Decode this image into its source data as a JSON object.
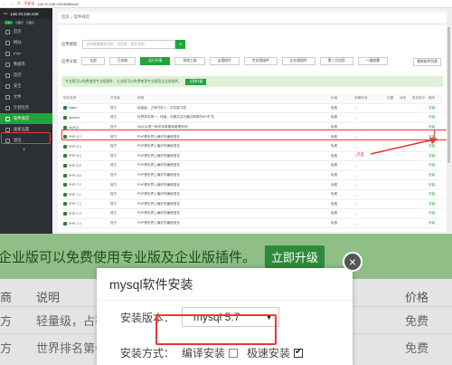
{
  "browser": {
    "warning": "不安全",
    "url": "148.70.236.239:8888/soft"
  },
  "sidebar": {
    "server": "148.70.236.239",
    "counts": [
      "0",
      "0",
      "0"
    ],
    "items": [
      {
        "label": "首页",
        "icon": "home-icon"
      },
      {
        "label": "网站",
        "icon": "globe-icon"
      },
      {
        "label": "FTP",
        "icon": "ftp-icon"
      },
      {
        "label": "数据库",
        "icon": "database-icon"
      },
      {
        "label": "监控",
        "icon": "monitor-icon"
      },
      {
        "label": "安全",
        "icon": "shield-icon"
      },
      {
        "label": "文件",
        "icon": "folder-icon"
      },
      {
        "label": "计划任务",
        "icon": "clock-icon"
      },
      {
        "label": "软件商店",
        "icon": "grid-icon"
      },
      {
        "label": "面板设置",
        "icon": "gear-icon"
      },
      {
        "label": "退出",
        "icon": "logout-icon"
      }
    ],
    "add": "+"
  },
  "breadcrumb": {
    "home": "首页",
    "sep": "/",
    "current": "软件商店"
  },
  "search": {
    "label": "应用搜索",
    "placeholder": "支持模糊搜索名称、字段等、插件说明"
  },
  "categories": {
    "label": "应用分类",
    "items": [
      "全部",
      "已安装",
      "运行环境",
      "系统工具",
      "宝塔插件",
      "专业版插件",
      "企业版插件",
      "第三方应用",
      "一键部署"
    ],
    "active_index": 2,
    "update": "更新软件列表"
  },
  "banner": {
    "text": "专业版可以免费使用专业版插件，企业版可以免费使用专业版及企业版插件。",
    "button": "立即升级"
  },
  "table": {
    "headers": [
      "软件名称",
      "开发商",
      "说明",
      "价格",
      "到期时间",
      "位置",
      "状态",
      "首页显示",
      "操作"
    ],
    "rows": [
      {
        "name": "Nginx",
        "dev": "官方",
        "desc": "轻量级，占有内存少，并发能力强",
        "price": "免费",
        "exp": "--",
        "op": "安装"
      },
      {
        "name": "Apache",
        "dev": "官方",
        "desc": "世界排名第一，快速、可靠并且可通过简单的API扩充",
        "price": "免费",
        "exp": "--",
        "op": "安装"
      },
      {
        "name": "MySQL",
        "dev": "官方",
        "desc": "MySQL是一种关系数据库管理系统!",
        "price": "免费",
        "exp": "--",
        "op": "安装"
      },
      {
        "name": "PHP-5.2",
        "dev": "官方",
        "desc": "PHP是世界上最好的编程语言",
        "price": "免费",
        "exp": "--",
        "op": "安装"
      },
      {
        "name": "PHP-5.3",
        "dev": "官方",
        "desc": "PHP是世界上最好的编程语言",
        "price": "免费",
        "exp": "--",
        "op": "安装"
      },
      {
        "name": "PHP-5.4",
        "dev": "官方",
        "desc": "PHP是世界上最好的编程语言",
        "price": "免费",
        "exp": "--",
        "op": "安装"
      },
      {
        "name": "PHP-5.5",
        "dev": "官方",
        "desc": "PHP是世界上最好的编程语言",
        "price": "免费",
        "exp": "--",
        "op": "安装"
      },
      {
        "name": "PHP-5.6",
        "dev": "官方",
        "desc": "PHP是世界上最好的编程语言",
        "price": "免费",
        "exp": "--",
        "op": "安装"
      },
      {
        "name": "PHP-7.0",
        "dev": "官方",
        "desc": "PHP是世界上最好的编程语言",
        "price": "免费",
        "exp": "--",
        "op": "安装"
      },
      {
        "name": "PHP-7.1",
        "dev": "官方",
        "desc": "PHP是世界上最好的编程语言",
        "price": "免费",
        "exp": "--",
        "op": "安装"
      },
      {
        "name": "PHP-7.2",
        "dev": "官方",
        "desc": "PHP是世界上最好的编程语言",
        "price": "免费",
        "exp": "--",
        "op": "安装"
      },
      {
        "name": "PHP-7.3",
        "dev": "官方",
        "desc": "PHP是世界上最好的编程语言",
        "price": "免费",
        "exp": "--",
        "op": "安装"
      },
      {
        "name": "PHP-7.4",
        "dev": "官方",
        "desc": "PHP是世界上最好的编程语言",
        "price": "免费",
        "exp": "--",
        "op": "安装"
      }
    ]
  },
  "annotation": {
    "click": "点击"
  },
  "zoom": {
    "banner_text": "企业版可以免费使用专业版及企业版插件。",
    "banner_button": "立即升级",
    "head_left": "商",
    "head_desc": "说明",
    "head_price": "价格",
    "rows": [
      {
        "left": "方",
        "desc": "轻量级，占有内存少",
        "price": "免费"
      },
      {
        "left": "方",
        "desc": "世界排名第一，快",
        "price": "免费"
      },
      {
        "left": "",
        "desc": "",
        "price": ""
      }
    ]
  },
  "modal": {
    "title": "mysql软件安装",
    "close": "×",
    "version_label": "安装版本：",
    "version_value": "mysql 5.7",
    "method_label": "安装方式：",
    "compile_label": "编译安装",
    "fast_label": "极速安装"
  },
  "colors": {
    "accent": "#20a53a",
    "highlight": "#e53935",
    "sidebar": "#2c2f33"
  }
}
